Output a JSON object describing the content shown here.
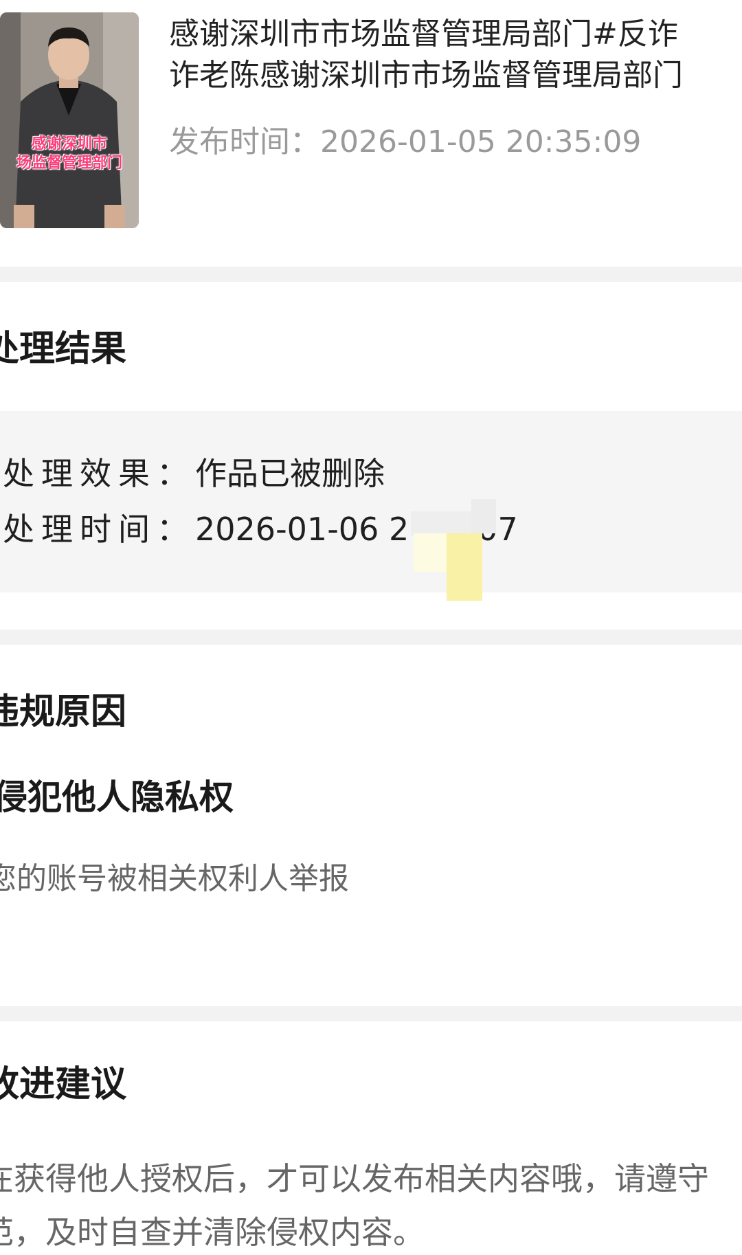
{
  "video": {
    "thumbnail_caption": "感谢深圳市\n场监督管理部门",
    "title": "感谢深圳市市场监督管理局部门#反诈\n诈老陈感谢深圳市市场监督管理局部门",
    "publish_label": "发布时间：",
    "publish_time": "2026-01-05 20:35:09"
  },
  "result": {
    "heading": "处理结果",
    "effect_label": "处理效果：",
    "effect_value": "作品已被删除",
    "time_label": "处理时间：",
    "time_value_visible": "2026-01-06 2",
    "time_value_tail": "07"
  },
  "violation": {
    "heading": "违规原因",
    "title": "侵犯他人隐私权",
    "description": "您的账号被相关权利人举报"
  },
  "suggestion": {
    "heading": "改进建议",
    "text": "在获得他人授权后，才可以发布相关内容哦，请遵守\n范，及时自查并清除侵权内容。"
  },
  "colors": {
    "background": "#ffffff",
    "divider": "#f2f2f2",
    "result_box": "#f5f5f5",
    "muted_text": "#9a9a9a",
    "caption_pink": "#ff3b7a"
  }
}
